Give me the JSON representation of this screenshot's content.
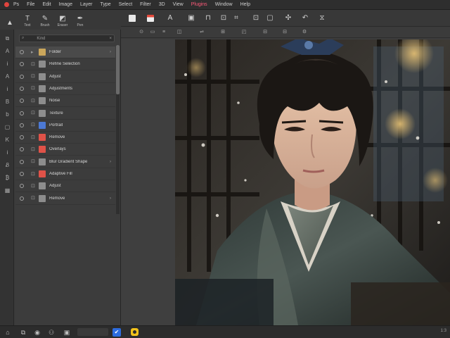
{
  "menubar": {
    "items": [
      "Ps",
      "File",
      "Edit",
      "Image",
      "Layer",
      "Type",
      "Select",
      "Filter",
      "3D",
      "View",
      "Plugins",
      "Window",
      "Help"
    ]
  },
  "left_toolbar": {
    "buttons": [
      {
        "icon": "shape-icon",
        "label": "Shapes"
      },
      {
        "icon": "text-icon",
        "label": "Text"
      },
      {
        "icon": "brush-icon",
        "label": "Brush"
      },
      {
        "icon": "eraser-icon",
        "label": "Eraser"
      },
      {
        "icon": "pen-icon",
        "label": "Pen"
      }
    ]
  },
  "layers": {
    "search_placeholder": "Kind",
    "items": [
      {
        "name": "Folder",
        "type": "folder",
        "selected": true
      },
      {
        "name": "Refine Selection",
        "type": "image"
      },
      {
        "name": "Adjust",
        "type": "image"
      },
      {
        "name": "Adjustments",
        "type": "image"
      },
      {
        "name": "Noise",
        "type": "image"
      },
      {
        "name": "Texture",
        "type": "image"
      },
      {
        "name": "Portrait",
        "type": "blue"
      },
      {
        "name": "Remove",
        "type": "red"
      },
      {
        "name": "Overlays",
        "type": "red"
      },
      {
        "name": "Blur Gradient Shape",
        "type": "image"
      },
      {
        "name": "Adaptive Fill",
        "type": "red"
      },
      {
        "name": "Adjust",
        "type": "image"
      },
      {
        "name": "Remove",
        "type": "image"
      }
    ]
  },
  "statusbar": {
    "zoom": "1:3"
  },
  "colors": {
    "panel_bg": "#3c3c3c",
    "accent_blue": "#2d6cdf",
    "accent_yellow": "#f2c21b",
    "accent_red": "#e0443e"
  }
}
